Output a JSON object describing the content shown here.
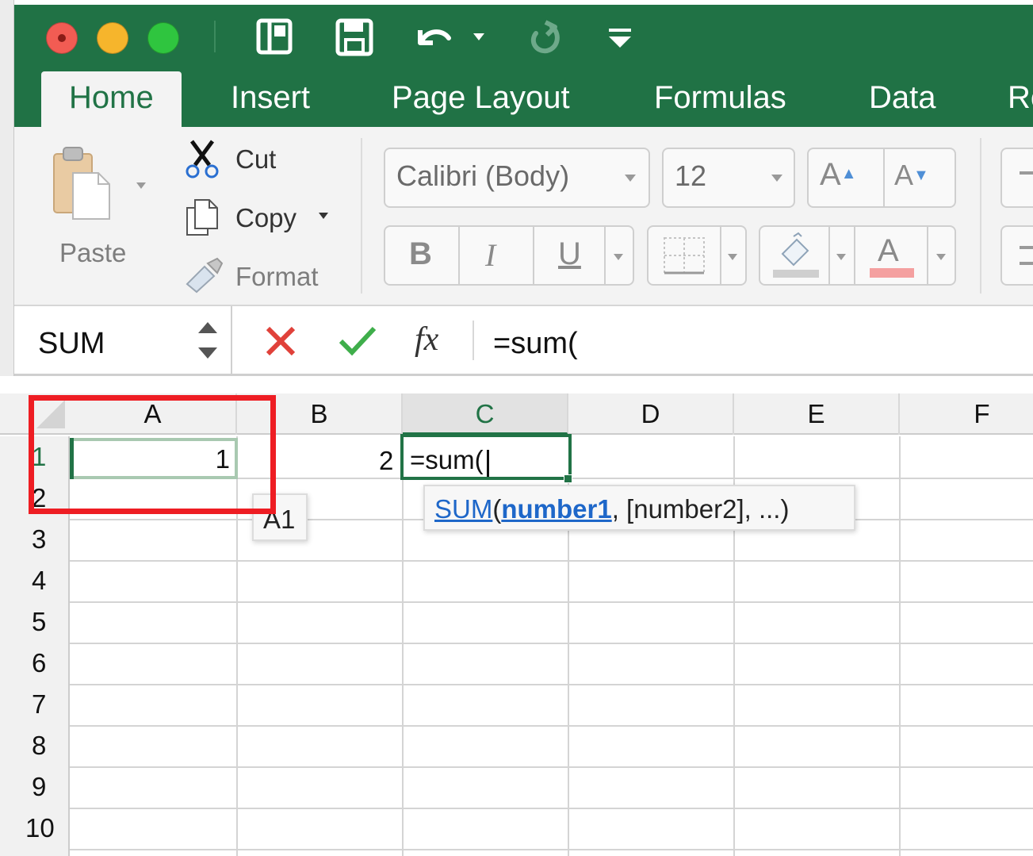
{
  "window": {
    "traffic_lights": [
      "close",
      "minimize",
      "zoom"
    ],
    "quick_access": [
      "sidebar-icon",
      "save-icon",
      "undo-icon",
      "undo-dropdown-icon",
      "redo-icon",
      "customize-toolbar-icon"
    ]
  },
  "tabs": [
    {
      "label": "Home",
      "active": true
    },
    {
      "label": "Insert",
      "active": false
    },
    {
      "label": "Page Layout",
      "active": false
    },
    {
      "label": "Formulas",
      "active": false
    },
    {
      "label": "Data",
      "active": false
    },
    {
      "label": "Re",
      "active": false
    }
  ],
  "ribbon": {
    "paste_label": "Paste",
    "cut_label": "Cut",
    "copy_label": "Copy",
    "format_label": "Format",
    "font_name": "Calibri (Body)",
    "font_size": "12",
    "grow_font": "A",
    "shrink_font": "A",
    "bold": "B",
    "italic": "I",
    "underline": "U",
    "font_color_letter": "A",
    "font_color_swatch": "#f4a0a0"
  },
  "formula_bar": {
    "name_box": "SUM",
    "cancel_icon": "cross-icon",
    "enter_icon": "check-icon",
    "fx_label": "fx",
    "formula": "=sum("
  },
  "grid": {
    "columns": [
      "A",
      "B",
      "C",
      "D",
      "E",
      "F"
    ],
    "active_column": "C",
    "rows": [
      "1",
      "2",
      "3",
      "4",
      "5",
      "6",
      "7",
      "8",
      "9",
      "10"
    ],
    "active_row": "1",
    "cells": {
      "A1": "1",
      "B1": "2",
      "C1": "=sum("
    },
    "reference_tooltip": "A1",
    "function_tooltip": {
      "name": "SUM",
      "open": "(",
      "arg1": "number1",
      "rest": ", [number2], ...)"
    }
  },
  "colors": {
    "excel_green": "#217346",
    "highlight_red": "#ee1d23",
    "link_blue": "#1e67c9"
  }
}
